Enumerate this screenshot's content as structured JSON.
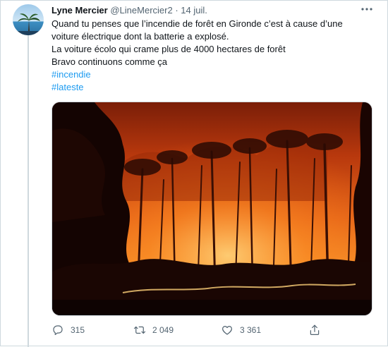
{
  "tweet": {
    "author_name": "Lyne Mercier",
    "handle": "@LineMercier2",
    "separator": "·",
    "date": "14 juil.",
    "text_lines": [
      "Quand tu penses que l’incendie de forêt en Gironde c’est à cause d’une",
      "voiture électrique dont la batterie a explosé.",
      "La voiture écolo qui crame plus de 4000 hectares de forêt",
      "Bravo continuons comme ça"
    ],
    "hashtags": [
      "#incendie",
      "#lateste"
    ],
    "more_icon": "more-horizontal-icon"
  },
  "actions": {
    "reply": {
      "icon": "reply-icon",
      "count": "315"
    },
    "retweet": {
      "icon": "retweet-icon",
      "count": "2 049"
    },
    "like": {
      "icon": "like-icon",
      "count": "3 361"
    },
    "share": {
      "icon": "share-icon"
    }
  },
  "colors": {
    "text": "#0f1419",
    "secondary": "#536471",
    "link": "#1d9bf0",
    "border": "#cfd9de"
  }
}
